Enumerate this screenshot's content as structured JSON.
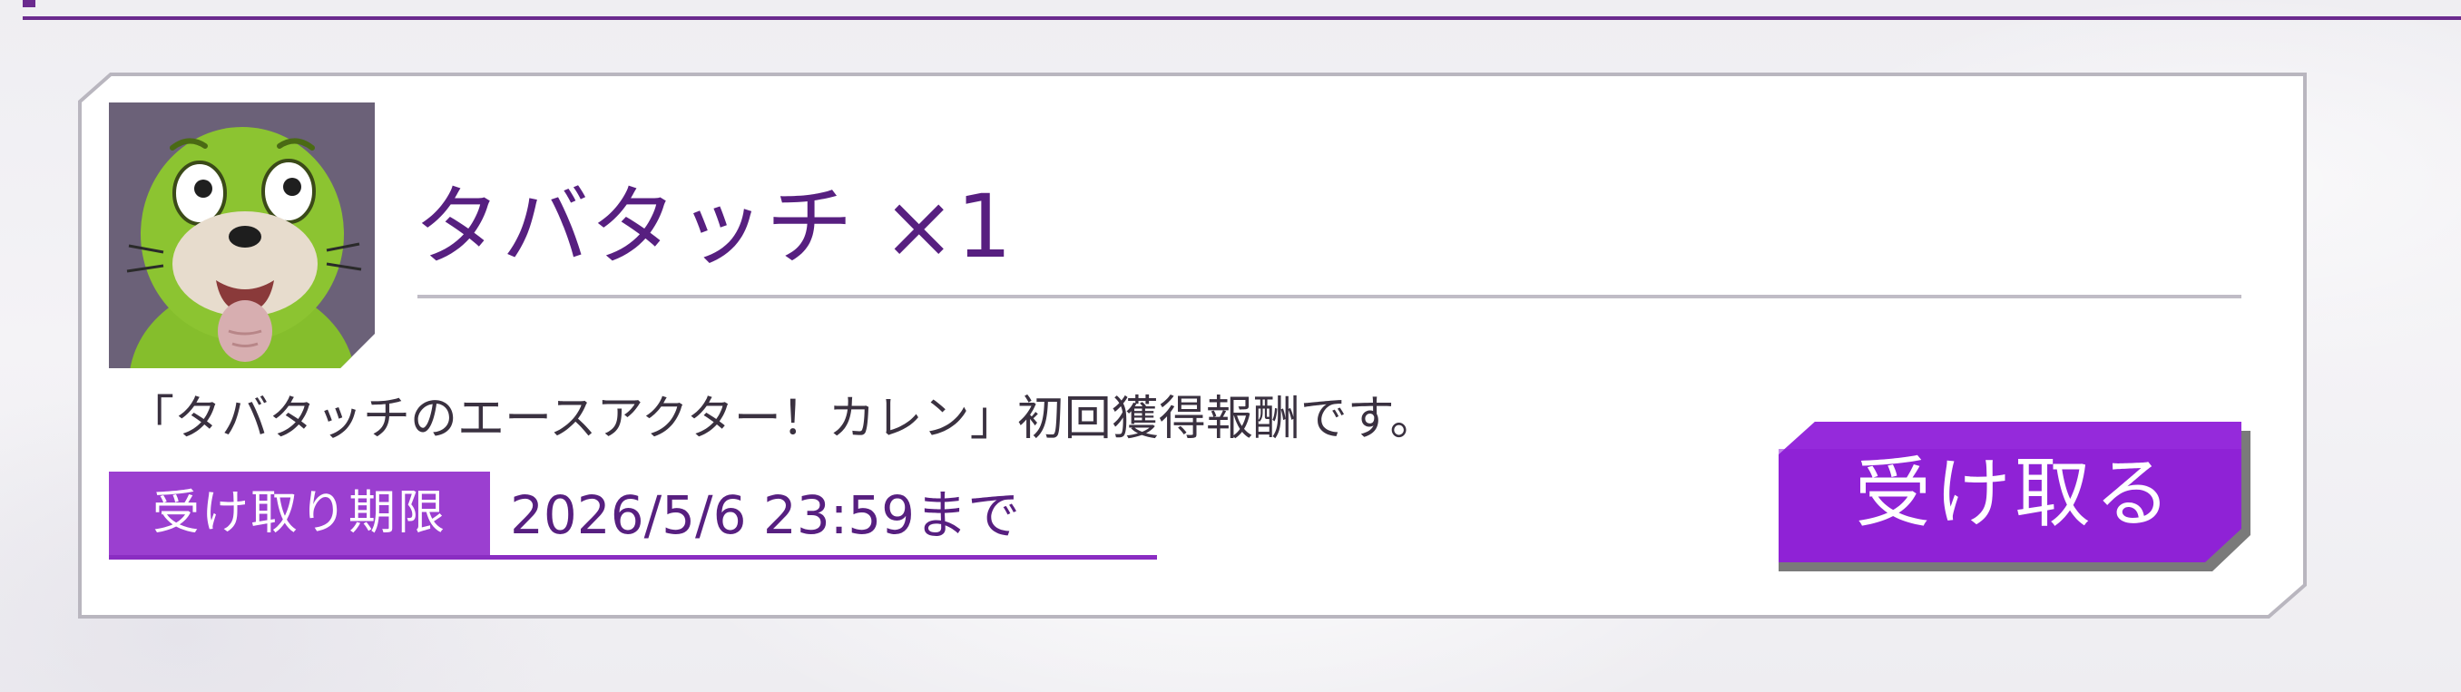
{
  "reward": {
    "item_name": "タバタッチ ×1",
    "description": "「タバタッチのエースアクター！カレン」初回獲得報酬です。",
    "deadline_label": "受け取り期限",
    "deadline_value": "2026/5/6 23:59まで",
    "claim_button_label": "受け取る",
    "item_icon": "green-sea-lion-mascot-icon"
  },
  "colors": {
    "accent": "#8a2dc2",
    "button": "#8f22d6",
    "title_text": "#571f80",
    "badge": "#9b3fd0"
  }
}
